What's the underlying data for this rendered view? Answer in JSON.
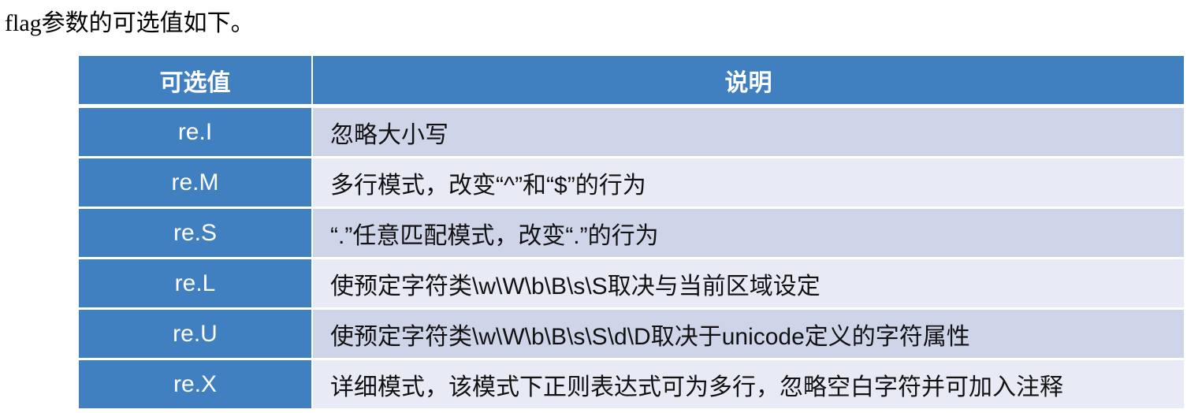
{
  "intro": "flag参数的可选值如下。",
  "table": {
    "headers": [
      "可选值",
      "说明"
    ],
    "rows": [
      {
        "value": "re.I",
        "desc": "忽略大小写"
      },
      {
        "value": "re.M",
        "desc": "多行模式，改变“^”和“$”的行为"
      },
      {
        "value": "re.S",
        "desc": "“.”任意匹配模式，改变“.”的行为"
      },
      {
        "value": "re.L",
        "desc": "使预定字符类\\w\\W\\b\\B\\s\\S取决与当前区域设定"
      },
      {
        "value": "re.U",
        "desc": "使预定字符类\\w\\W\\b\\B\\s\\S\\d\\D取决于unicode定义的字符属性"
      },
      {
        "value": "re.X",
        "desc": "详细模式，该模式下正则表达式可为多行，忽略空白字符并可加入注释"
      }
    ]
  },
  "colors": {
    "header": "#4080c1",
    "row_odd": "#cfd5e9",
    "row_even": "#e8ebf5"
  }
}
